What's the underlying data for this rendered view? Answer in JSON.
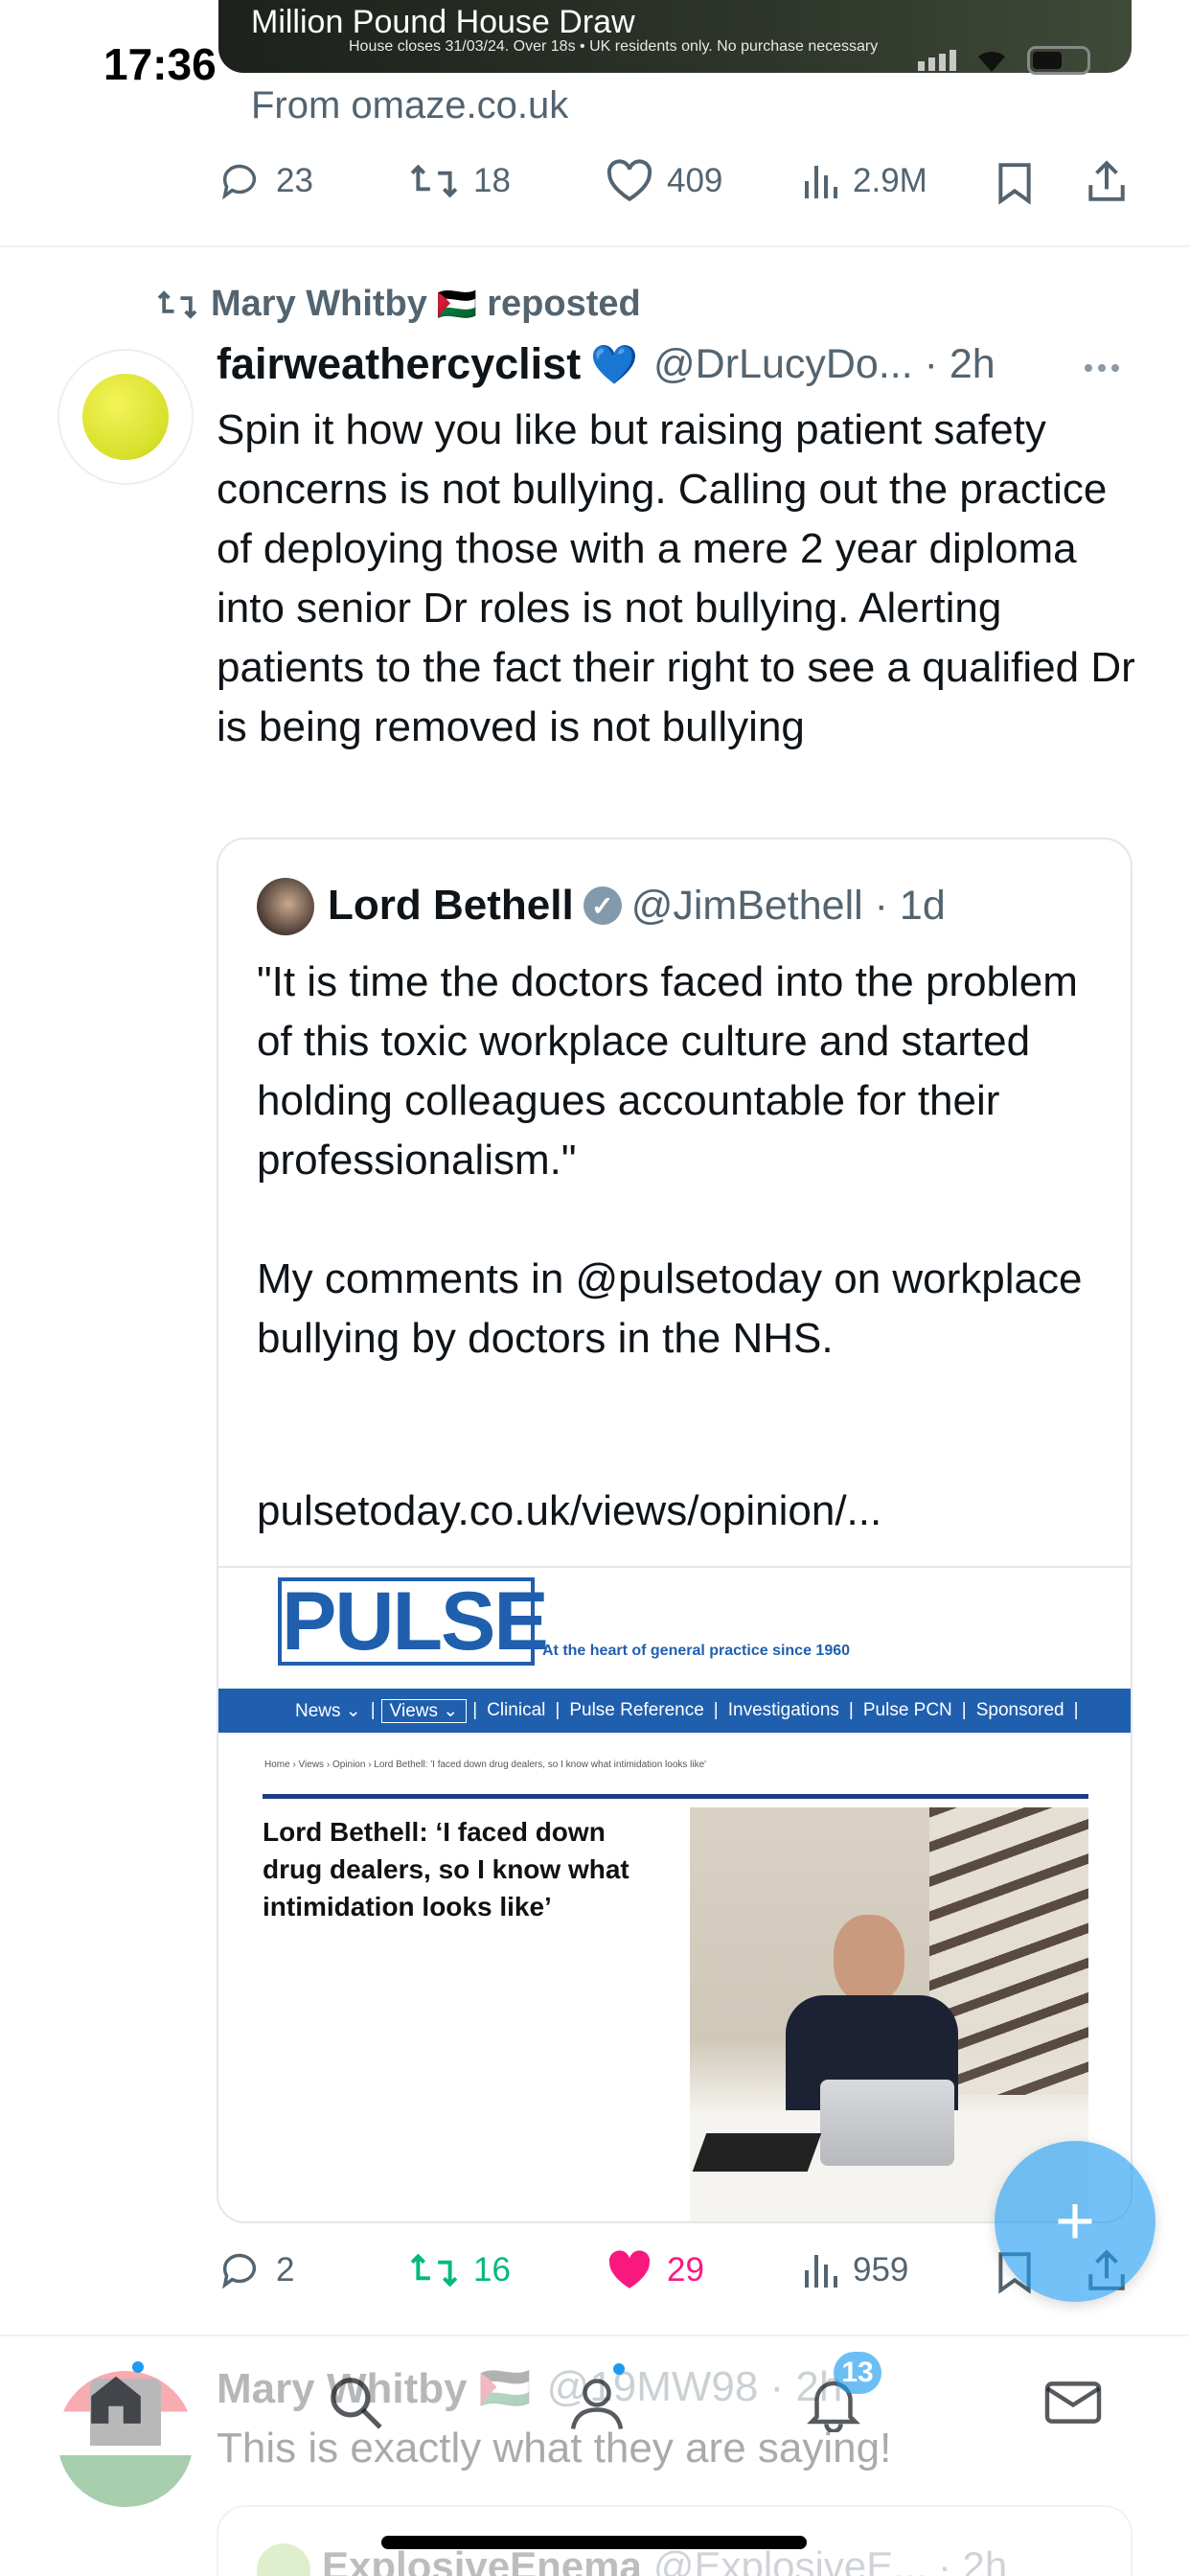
{
  "status_bar": {
    "time": "17:36"
  },
  "prev_tweet": {
    "ad_title": "Million Pound House Draw",
    "ad_subtitle": "House closes 31/03/24. Over 18s • UK residents only. No purchase necessary",
    "ad_source": "From omaze.co.uk",
    "stats": {
      "replies": "23",
      "reposts": "18",
      "likes": "409",
      "views": "2.9M"
    }
  },
  "tweet": {
    "reposter_prefix": "Mary Whitby",
    "reposter_flag": "🇵🇸",
    "reposted_label": "reposted",
    "author": "fairweathercyclist",
    "author_emoji": "💙",
    "handle_time": "@DrLucyDo... · 2h",
    "text": "Spin it how you like but raising patient safety concerns is not bullying. Calling out the practice of deploying those with a mere 2 year diploma into senior Dr roles is not bullying. Alerting patients to the fact their right to see a qualified Dr is being removed is not bullying",
    "quote": {
      "author": "Lord Bethell",
      "handle_time": "@JimBethell · 1d",
      "para1": "\"It is time the doctors faced into the problem of this toxic workplace culture and started holding colleagues accountable for their professionalism.\"",
      "para2": "My comments in @pulsetoday on workplace bullying by doctors in the NHS.",
      "link": "pulsetoday.co.uk/views/opinion/...",
      "card": {
        "logo": "PULSE",
        "tagline": "At the heart of general practice since 1960",
        "nav": [
          "News ⌄",
          "Views ⌄",
          "Clinical",
          "Pulse Reference",
          "Investigations",
          "Pulse PCN",
          "Sponsored"
        ],
        "breadcrumb": "Home › Views › Opinion › Lord Bethell: 'I faced down drug dealers, so I know what intimidation looks like'",
        "headline": "Lord Bethell: ‘I faced down drug dealers, so I know what intimidation looks like’"
      }
    },
    "stats": {
      "replies": "2",
      "reposts": "16",
      "likes": "29",
      "views": "959"
    }
  },
  "next_tweet": {
    "author": "Mary Whitby 🇵🇸",
    "handle": "@19MW98 · 2h",
    "text": "This is exactly what they are saying!",
    "quote_author": "ExplosiveEnema",
    "quote_handle": "@ExplosiveE... · 2h"
  },
  "tab_bar": {
    "notifications_badge": "13"
  },
  "colors": {
    "accent": "#1d9bf0",
    "repost_green": "#00ba7c",
    "like_pink": "#f91880",
    "pulse_blue": "#1f5fae"
  }
}
